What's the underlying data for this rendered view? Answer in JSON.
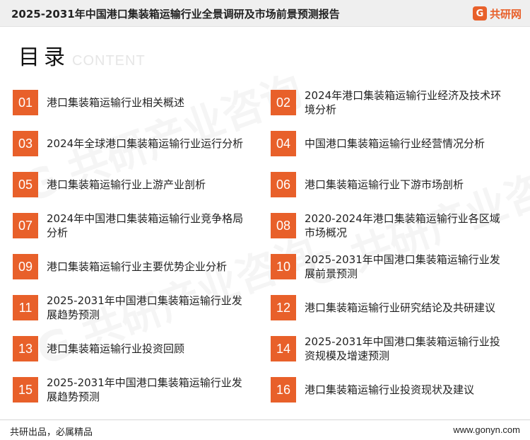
{
  "header": {
    "report_title": "2025-2031年中国港口集装箱运输行业全景调研及市场前景预测报告",
    "logo_mark": "G",
    "logo_text": "共研网"
  },
  "toc": {
    "title": "目录",
    "subtitle": "CONTENT",
    "items": [
      {
        "num": "01",
        "text": "港口集装箱运输行业相关概述"
      },
      {
        "num": "02",
        "text": "2024年港口集装箱运输行业经济及技术环境分析"
      },
      {
        "num": "03",
        "text": "2024年全球港口集装箱运输行业运行分析"
      },
      {
        "num": "04",
        "text": "中国港口集装箱运输行业经营情况分析"
      },
      {
        "num": "05",
        "text": "港口集装箱运输行业上游产业剖析"
      },
      {
        "num": "06",
        "text": "港口集装箱运输行业下游市场剖析"
      },
      {
        "num": "07",
        "text": "2024年中国港口集装箱运输行业竞争格局分析"
      },
      {
        "num": "08",
        "text": "2020-2024年港口集装箱运输行业各区域市场概况"
      },
      {
        "num": "09",
        "text": "港口集装箱运输行业主要优势企业分析"
      },
      {
        "num": "10",
        "text": "2025-2031年中国港口集装箱运输行业发展前景预测"
      },
      {
        "num": "11",
        "text": "2025-2031年中国港口集装箱运输行业发展趋势预测"
      },
      {
        "num": "12",
        "text": "港口集装箱运输行业研究结论及共研建议"
      },
      {
        "num": "13",
        "text": "港口集装箱运输行业投资回顾"
      },
      {
        "num": "14",
        "text": "2025-2031年中国港口集装箱运输行业投资规模及增速预测"
      },
      {
        "num": "15",
        "text": "2025-2031年中国港口集装箱运输行业发展趋势预测"
      },
      {
        "num": "16",
        "text": "港口集装箱运输行业投资现状及建议"
      }
    ]
  },
  "footer": {
    "slogan": "共研出品，必属精品",
    "url": "www.gonyn.com"
  }
}
